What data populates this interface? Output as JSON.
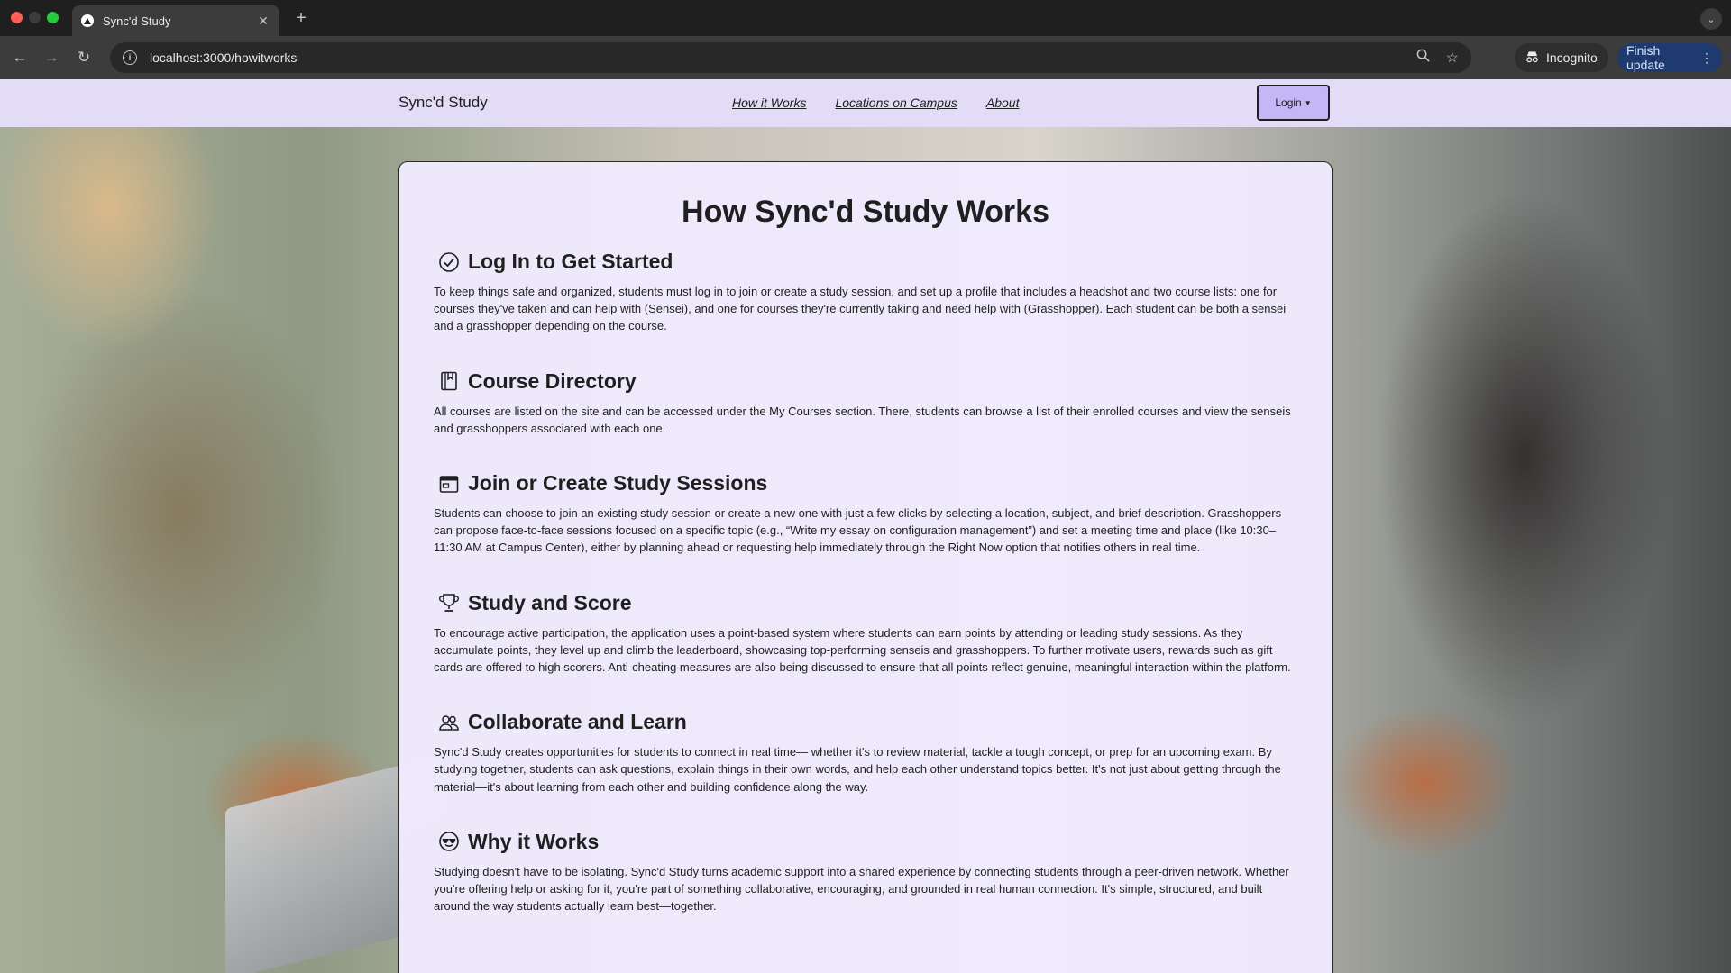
{
  "browser": {
    "tab_title": "Sync'd Study",
    "tab_close": "✕",
    "new_tab": "+",
    "url": "localhost:3000/howitworks",
    "incognito_label": "Incognito",
    "finish_update_label": "Finish update"
  },
  "site": {
    "brand": "Sync'd Study",
    "nav": [
      {
        "label": "How it Works"
      },
      {
        "label": "Locations on Campus"
      },
      {
        "label": "About"
      }
    ],
    "login_label": "Login"
  },
  "page": {
    "title": "How Sync'd Study Works",
    "sections": [
      {
        "icon": "check-circle-icon",
        "title": "Log In to Get Started",
        "body": "To keep things safe and organized, students must log in to join or create a study session, and set up a profile that includes a headshot and two course lists: one for courses they've taken and can help with (Sensei), and one for courses they're currently taking and need help with (Grasshopper). Each student can be both a sensei and a grasshopper depending on the course."
      },
      {
        "icon": "book-icon",
        "title": "Course Directory",
        "body": "All courses are listed on the site and can be accessed under the My Courses section. There, students can browse a list of their enrolled courses and view the senseis and grasshoppers associated with each one."
      },
      {
        "icon": "calendar-icon",
        "title": "Join or Create Study Sessions",
        "body": "Students can choose to join an existing study session or create a new one with just a few clicks by selecting a location, subject, and brief description. Grasshoppers can propose face-to-face sessions focused on a specific topic (e.g., “Write my essay on configuration management”) and set a meeting time and place (like 10:30–11:30 AM at Campus Center), either by planning ahead or requesting help immediately through the Right Now option that notifies others in real time."
      },
      {
        "icon": "trophy-icon",
        "title": "Study and Score",
        "body": "To encourage active participation, the application uses a point-based system where students can earn points by attending or leading study sessions. As they accumulate points, they level up and climb the leaderboard, showcasing top-performing senseis and grasshoppers. To further motivate users, rewards such as gift cards are offered to high scorers. Anti-cheating measures are also being discussed to ensure that all points reflect genuine, meaningful interaction within the platform."
      },
      {
        "icon": "people-icon",
        "title": "Collaborate and Learn",
        "body": "Sync'd Study creates opportunities for students to connect in real time— whether it's to review material, tackle a tough concept, or prep for an upcoming exam. By studying together, students can ask questions, explain things in their own words, and help each other understand topics better. It's not just about getting through the material—it's about learning from each other and building confidence along the way."
      },
      {
        "icon": "smiling-face-sunglasses-icon",
        "title": "Why it Works",
        "body": "Studying doesn't have to be isolating. Sync'd Study turns academic support into a shared experience by connecting students through a peer-driven network. Whether you're offering help or asking for it, you're part of something collaborative, encouraging, and grounded in real human connection. It's simple, structured, and built around the way students actually learn best—together."
      }
    ]
  },
  "colors": {
    "navbar_bg": "#e3dcf7",
    "login_bg": "#c5b7f5",
    "card_bg": "#efeafd",
    "text": "#1f1f1f"
  }
}
